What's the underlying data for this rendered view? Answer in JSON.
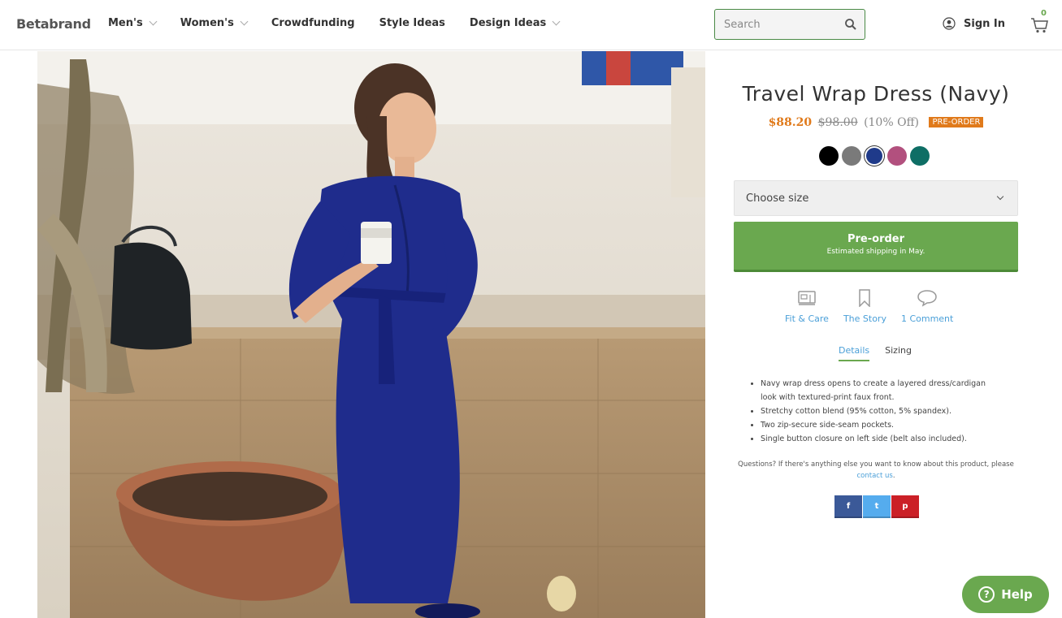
{
  "header": {
    "logo": "Betabrand",
    "nav": [
      {
        "label": "Men's",
        "dropdown": true
      },
      {
        "label": "Women's",
        "dropdown": true
      },
      {
        "label": "Crowdfunding",
        "dropdown": false
      },
      {
        "label": "Style Ideas",
        "dropdown": false
      },
      {
        "label": "Design Ideas",
        "dropdown": true
      }
    ],
    "search_placeholder": "Search",
    "sign_in": "Sign In",
    "cart_count": "0"
  },
  "product": {
    "title": "Travel Wrap Dress (Navy)",
    "price_now": "$88.20",
    "price_was": "$98.00",
    "price_off": "(10% Off)",
    "badge": "PRE-ORDER",
    "swatch_colors": [
      "#000000",
      "#7a7a7a",
      "#1f3a8a",
      "#b2507e",
      "#0e6e65"
    ],
    "selected_swatch": 2,
    "size_placeholder": "Choose size",
    "preorder_label": "Pre-order",
    "preorder_sub": "Estimated shipping in May.",
    "actions": [
      {
        "label": "Fit & Care",
        "icon": "sewing-machine-icon"
      },
      {
        "label": "The Story",
        "icon": "bookmark-icon"
      },
      {
        "label": "1 Comment",
        "icon": "speech-bubble-icon"
      }
    ],
    "tabs": [
      "Details",
      "Sizing"
    ],
    "active_tab": "Details",
    "details": [
      "Navy wrap dress opens to create a layered dress/cardigan look with textured-print faux front.",
      "Stretchy cotton blend (95% cotton, 5% spandex).",
      "Two zip-secure side-seam pockets.",
      "Single button closure on left side (belt also included)."
    ],
    "questions_text": "Questions? If there's anything else you want to know about this product, please",
    "contact_link": "contact us",
    "questions_end": "."
  },
  "share": [
    {
      "label": "f",
      "color": "#3b5998",
      "icon": "facebook-icon"
    },
    {
      "label": "t",
      "color": "#55acee",
      "icon": "twitter-icon"
    },
    {
      "label": "p",
      "color": "#cb2027",
      "icon": "pinterest-icon"
    }
  ],
  "help": {
    "label": "Help"
  }
}
